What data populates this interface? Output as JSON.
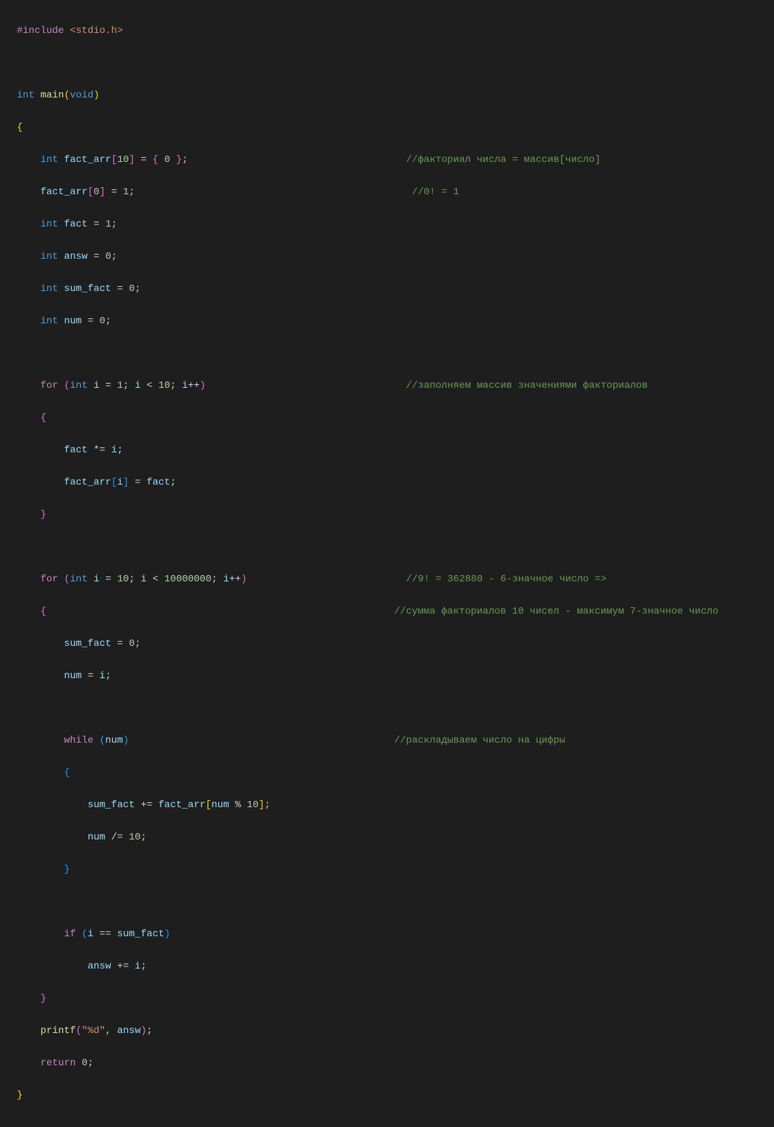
{
  "code": {
    "line1_pre": "#include",
    "line1_inc": " <stdio.h>",
    "line3_int": "int",
    "line3_main": " main",
    "line3_paren_o": "(",
    "line3_void": "void",
    "line3_paren_c": ")",
    "line4_brace": "{",
    "line5_int": "int",
    "line5_var": " fact_arr",
    "line5_b1": "[",
    "line5_n10": "10",
    "line5_b2": "]",
    "line5_eq": " = ",
    "line5_b3": "{ ",
    "line5_n0": "0",
    "line5_b4": " }",
    "line5_semi": ";",
    "line5_comment": "//факториал числа = массив[число]",
    "line6_var": "fact_arr",
    "line6_b1": "[",
    "line6_n0a": "0",
    "line6_b2": "]",
    "line6_eq": " = ",
    "line6_n1": "1",
    "line6_semi": ";",
    "line6_comment": "//0! = 1",
    "line7_int": "int",
    "line7_var": " fact",
    "line7_eq": " = ",
    "line7_n": "1",
    "line7_semi": ";",
    "line8_int": "int",
    "line8_var": " answ",
    "line8_eq": " = ",
    "line8_n": "0",
    "line8_semi": ";",
    "line9_int": "int",
    "line9_var": " sum_fact",
    "line9_eq": " = ",
    "line9_n": "0",
    "line9_semi": ";",
    "line10_int": "int",
    "line10_var": " num",
    "line10_eq": " = ",
    "line10_n": "0",
    "line10_semi": ";",
    "line12_for": "for",
    "line12_po": " (",
    "line12_int": "int",
    "line12_var1": " i",
    "line12_eq": " = ",
    "line12_n1": "1",
    "line12_s1": "; ",
    "line12_var2": "i",
    "line12_lt": " < ",
    "line12_n10": "10",
    "line12_s2": "; ",
    "line12_var3": "i",
    "line12_inc": "++",
    "line12_pc": ")",
    "line12_comment": "//заполняем массив значениями факториалов",
    "line13_brace": "{",
    "line14_var1": "fact",
    "line14_op": " *= ",
    "line14_var2": "i",
    "line14_semi": ";",
    "line15_var1": "fact_arr",
    "line15_b1": "[",
    "line15_var2": "i",
    "line15_b2": "]",
    "line15_eq": " = ",
    "line15_var3": "fact",
    "line15_semi": ";",
    "line16_brace": "}",
    "line18_for": "for",
    "line18_po": " (",
    "line18_int": "int",
    "line18_var1": " i",
    "line18_eq": " = ",
    "line18_n10": "10",
    "line18_s1": "; ",
    "line18_var2": "i",
    "line18_lt": " < ",
    "line18_nbig": "10000000",
    "line18_s2": "; ",
    "line18_var3": "i",
    "line18_inc": "++",
    "line18_pc": ")",
    "line18_comment": "//9! = 362880 - 6-значное число =>",
    "line19_brace": "{",
    "line19_comment": "//сумма факториалов 10 чисел - максимум 7-значное число",
    "line20_var": "sum_fact",
    "line20_eq": " = ",
    "line20_n": "0",
    "line20_semi": ";",
    "line21_var1": "num",
    "line21_eq": " = ",
    "line21_var2": "i",
    "line21_semi": ";",
    "line23_while": "while",
    "line23_po": " (",
    "line23_var": "num",
    "line23_pc": ")",
    "line23_comment": "//раскладываем число на цифры",
    "line24_brace": "{",
    "line25_var1": "sum_fact",
    "line25_op": " += ",
    "line25_var2": "fact_arr",
    "line25_b1": "[",
    "line25_var3": "num",
    "line25_mod": " % ",
    "line25_n": "10",
    "line25_b2": "]",
    "line25_semi": ";",
    "line26_var": "num",
    "line26_op": " /= ",
    "line26_n": "10",
    "line26_semi": ";",
    "line27_brace": "}",
    "line29_if": "if",
    "line29_po": " (",
    "line29_var1": "i",
    "line29_eq": " == ",
    "line29_var2": "sum_fact",
    "line29_pc": ")",
    "line30_var1": "answ",
    "line30_op": " += ",
    "line30_var2": "i",
    "line30_semi": ";",
    "line31_brace": "}",
    "line32_func": "printf",
    "line32_po": "(",
    "line32_str": "\"%d\"",
    "line32_c": ", ",
    "line32_var": "answ",
    "line32_pc": ")",
    "line32_semi": ";",
    "line33_ret": "return",
    "line33_sp": " ",
    "line33_n": "0",
    "line33_semi": ";",
    "line34_brace": "}"
  }
}
